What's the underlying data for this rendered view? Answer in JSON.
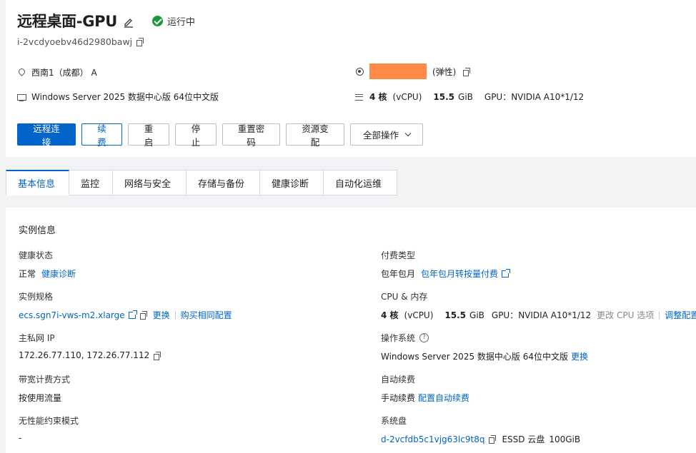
{
  "header": {
    "title": "远程桌面-GPU",
    "status": "运行中",
    "instance_id": "i-2vcdyoebv46d2980bawj",
    "region": "西南1（成都） A",
    "ip_suffix": "(弹性)",
    "os": "Windows Server 2025 数据中心版 64位中文版",
    "spec": {
      "cores": "4 核",
      "vcpu": "(vCPU)",
      "mem": "15.5",
      "mem_unit": "GiB",
      "gpu": "GPU：NVIDIA A10*1/12"
    }
  },
  "actions": [
    "远程连接",
    "续费",
    "重启",
    "停止",
    "重置密码",
    "资源变配",
    "全部操作"
  ],
  "tabs": [
    "基本信息",
    "监控",
    "网络与安全",
    "存储与备份",
    "健康诊断",
    "自动化运维"
  ],
  "section": {
    "title": "实例信息",
    "health": {
      "label": "健康状态",
      "value": "正常",
      "link": "健康诊断"
    },
    "billing": {
      "label": "付费类型",
      "value": "包年包月",
      "link": "包年包月转按量付费"
    },
    "spec": {
      "label": "实例规格",
      "value": "ecs.sgn7i-vws-m2.xlarge",
      "link1": "更换",
      "link2": "购买相同配置"
    },
    "cpu_mem": {
      "label": "CPU & 内存",
      "cores": "4 核",
      "vcpu": "(vCPU)",
      "mem": "15.5",
      "mem_unit": "GiB",
      "gpu": "GPU：NVIDIA A10*1/12",
      "muted": "更改 CPU 选项",
      "link": "调整配置"
    },
    "private_ip": {
      "label": "主私网 IP",
      "value": "172.26.77.110, 172.26.77.112"
    },
    "os": {
      "label": "操作系统",
      "value": "Windows Server 2025 数据中心版 64位中文版",
      "link": "更换"
    },
    "bandwidth": {
      "label": "带宽计费方式",
      "value": "按使用流量"
    },
    "auto_renew": {
      "label": "自动续费",
      "value": "手动续费",
      "link": "配置自动续费"
    },
    "burst": {
      "label": "无性能约束模式",
      "value": "-"
    },
    "system_disk": {
      "label": "系统盘",
      "value": "d-2vcfdb5c1vjg63lc9t8q",
      "type": "ESSD 云盘",
      "size": "100GiB"
    }
  },
  "colors": {
    "primary": "#0064c8",
    "status_ok": "#1a9a3a",
    "redaction": "#ff8a45"
  },
  "icons": [
    "edit-icon",
    "status-check-icon",
    "copy-icon",
    "location-icon",
    "os-icon",
    "ip-icon",
    "spec-icon",
    "chevron-down-icon",
    "external-link-icon",
    "help-icon"
  ]
}
